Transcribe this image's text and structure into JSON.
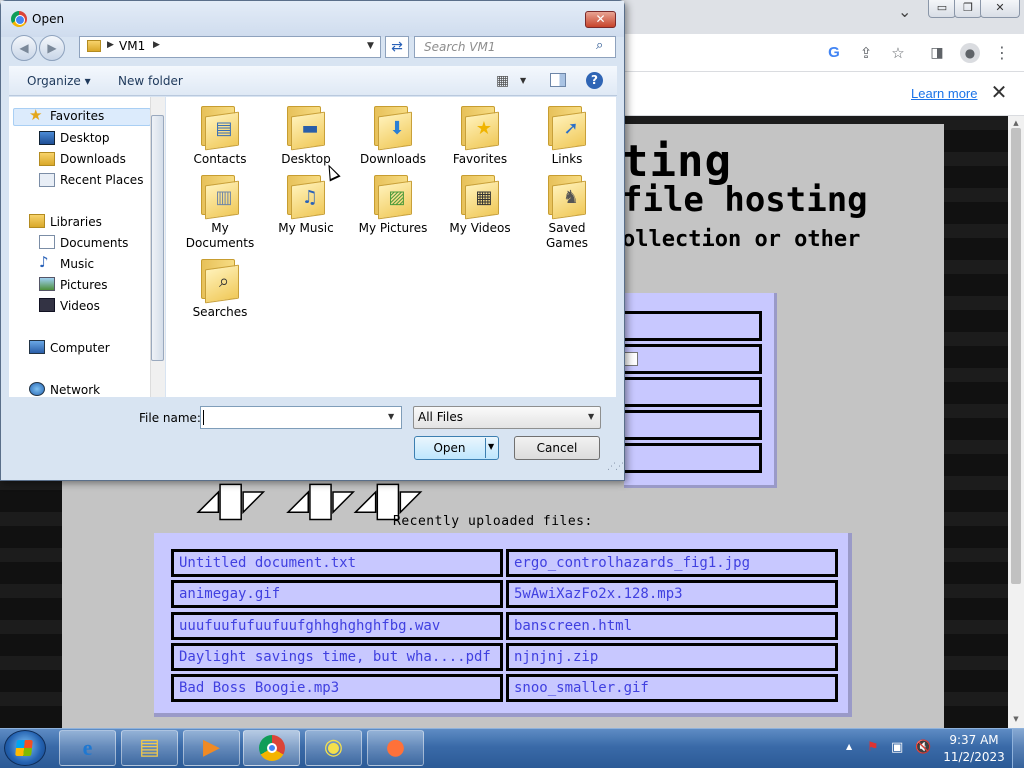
{
  "browser": {
    "window_controls": {
      "minimize": "▭",
      "restore": "❐",
      "close": "✕"
    },
    "tab_strip_chevron": "⌄",
    "toolbar_icons": [
      "google-icon",
      "share-icon",
      "star-icon",
      "sidebar-icon",
      "profile-icon",
      "menu-icon"
    ],
    "infobar": {
      "learn_more": "Learn more",
      "close": "✕"
    }
  },
  "page": {
    "title": "ting",
    "subtitle": "file hosting",
    "description": "ollection or other",
    "recent_label": "Recently uploaded files:",
    "recent_files": [
      [
        "Untitled document.txt",
        "ergo_controlhazards_fig1.jpg"
      ],
      [
        "animegay.gif",
        "5wAwiXazFo2x.128.mp3"
      ],
      [
        "uuufuufufuufuufghhghghghfbg.wav",
        "banscreen.html"
      ],
      [
        "Daylight savings time, but wha....pdf",
        "njnjnj.zip"
      ],
      [
        "Bad Boss Boogie.mp3",
        "snoo_smaller.gif"
      ]
    ],
    "colors": {
      "panel": "#c8c8ff",
      "link": "#4040e0"
    }
  },
  "dialog": {
    "title": "Open",
    "close": "✕",
    "address": {
      "location": "VM1",
      "sep": "▶",
      "dropdown": "▼"
    },
    "search_placeholder": "Search VM1",
    "commands": {
      "organize": "Organize ▾",
      "new_folder": "New folder",
      "view_arrow": "▼",
      "help": "?"
    },
    "nav": {
      "favorites": {
        "label": "Favorites",
        "items": [
          "Desktop",
          "Downloads",
          "Recent Places"
        ]
      },
      "libraries": {
        "label": "Libraries",
        "items": [
          "Documents",
          "Music",
          "Pictures",
          "Videos"
        ]
      },
      "computer": "Computer",
      "network": "Network"
    },
    "folders": [
      {
        "name": "Contacts",
        "icon": "contacts-icon"
      },
      {
        "name": "Desktop",
        "icon": "desktop-icon"
      },
      {
        "name": "Downloads",
        "icon": "downloads-icon"
      },
      {
        "name": "Favorites",
        "icon": "favorites-icon"
      },
      {
        "name": "Links",
        "icon": "links-icon"
      },
      {
        "name": "My Documents",
        "icon": "documents-icon"
      },
      {
        "name": "My Music",
        "icon": "music-icon"
      },
      {
        "name": "My Pictures",
        "icon": "pictures-icon"
      },
      {
        "name": "My Videos",
        "icon": "videos-icon"
      },
      {
        "name": "Saved Games",
        "icon": "games-icon"
      },
      {
        "name": "Searches",
        "icon": "searches-icon"
      }
    ],
    "file_name_label": "File name:",
    "file_name_value": "",
    "file_type": "All Files",
    "open_button": "Open",
    "cancel_button": "Cancel"
  },
  "taskbar": {
    "apps": [
      "internet-explorer-icon",
      "file-explorer-icon",
      "media-player-icon",
      "chrome-icon",
      "remote-desktop-icon",
      "firefox-icon"
    ],
    "time": "9:37 AM",
    "date": "11/2/2023"
  }
}
